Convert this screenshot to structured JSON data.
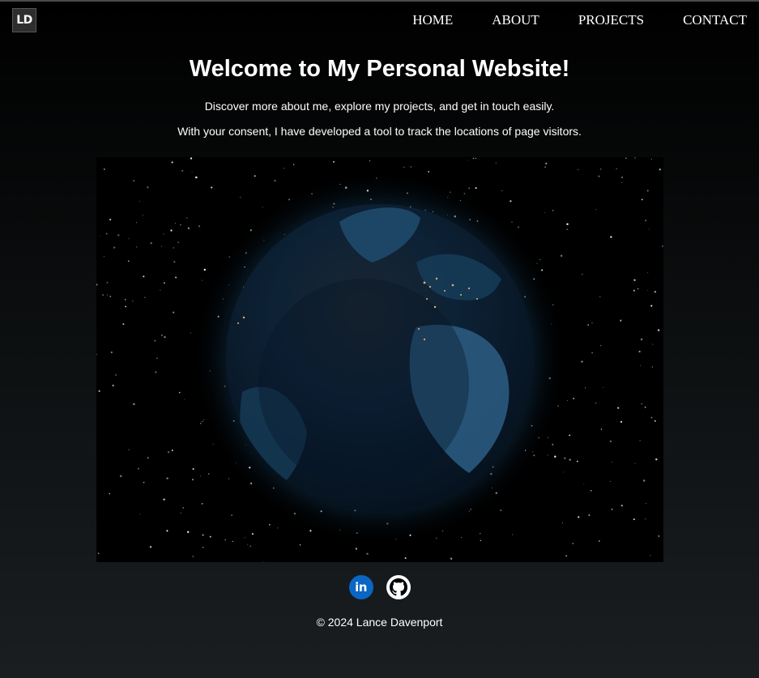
{
  "logo": {
    "text": "LD"
  },
  "nav": {
    "items": [
      "HOME",
      "ABOUT",
      "PROJECTS",
      "CONTACT"
    ]
  },
  "hero": {
    "title": "Welcome to My Personal Website!",
    "subtitle": "Discover more about me, explore my projects, and get in touch easily.",
    "consent_note": "With your consent, I have developed a tool to track the locations of page visitors."
  },
  "globe": {
    "description_icon": "earth-globe",
    "colors": {
      "space": "#000000",
      "ocean": "#0b2a44",
      "land": "#1f4a6b",
      "glow": "#1d5d8a",
      "city_lights": "#f0b060"
    }
  },
  "social": {
    "linkedin": {
      "icon": "linkedin-icon",
      "text": "in",
      "color": "#0a66c2"
    },
    "github": {
      "icon": "github-icon",
      "color": "#ffffff"
    }
  },
  "footer": {
    "copyright": "© 2024 Lance Davenport"
  }
}
